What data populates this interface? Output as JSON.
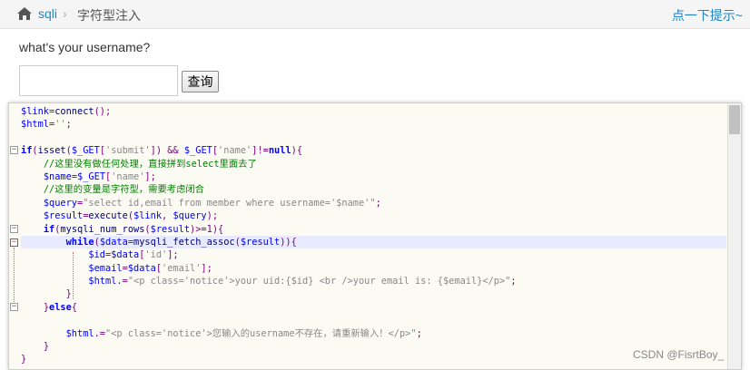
{
  "header": {
    "home_icon": "home-icon",
    "breadcrumb_sqli": "sqli",
    "breadcrumb_sep": "›",
    "breadcrumb_current": "字符型注入",
    "hint_link": "点一下提示~"
  },
  "form": {
    "prompt": "what's your username?",
    "input_value": "",
    "submit_label": "查询"
  },
  "code_lines": [
    [
      [
        "var",
        "$link"
      ],
      [
        "op",
        "="
      ],
      [
        "fn",
        "connect"
      ],
      [
        "op",
        "();"
      ]
    ],
    [
      [
        "var",
        "$html"
      ],
      [
        "op",
        "="
      ],
      [
        "str",
        "''"
      ],
      [
        "op",
        ";"
      ]
    ],
    [],
    [
      [
        "kw",
        "if"
      ],
      [
        "op",
        "("
      ],
      [
        "fn",
        "isset"
      ],
      [
        "op",
        "("
      ],
      [
        "var",
        "$_GET"
      ],
      [
        "op",
        "["
      ],
      [
        "str",
        "'submit'"
      ],
      [
        "op",
        "])"
      ],
      [
        "txt",
        " "
      ],
      [
        "op",
        "&&"
      ],
      [
        "txt",
        " "
      ],
      [
        "var",
        "$_GET"
      ],
      [
        "op",
        "["
      ],
      [
        "str",
        "'name'"
      ],
      [
        "op",
        "]!="
      ],
      [
        "kw",
        "null"
      ],
      [
        "op",
        "){"
      ]
    ],
    [
      [
        "txt",
        "    "
      ],
      [
        "cmt",
        "//这里没有做任何处理，直接拼到select里面去了"
      ]
    ],
    [
      [
        "txt",
        "    "
      ],
      [
        "var",
        "$name"
      ],
      [
        "op",
        "="
      ],
      [
        "var",
        "$_GET"
      ],
      [
        "op",
        "["
      ],
      [
        "str",
        "'name'"
      ],
      [
        "op",
        "];"
      ]
    ],
    [
      [
        "txt",
        "    "
      ],
      [
        "cmt",
        "//这里的变量是字符型，需要考虑闭合"
      ]
    ],
    [
      [
        "txt",
        "    "
      ],
      [
        "var",
        "$query"
      ],
      [
        "op",
        "="
      ],
      [
        "str",
        "\"select id,email from member where username='$name'\""
      ],
      [
        "op",
        ";"
      ]
    ],
    [
      [
        "txt",
        "    "
      ],
      [
        "var",
        "$result"
      ],
      [
        "op",
        "="
      ],
      [
        "fn",
        "execute"
      ],
      [
        "op",
        "("
      ],
      [
        "var",
        "$link"
      ],
      [
        "op",
        ","
      ],
      [
        "txt",
        " "
      ],
      [
        "var",
        "$query"
      ],
      [
        "op",
        ");"
      ]
    ],
    [
      [
        "txt",
        "    "
      ],
      [
        "kw",
        "if"
      ],
      [
        "op",
        "("
      ],
      [
        "fn",
        "mysqli_num_rows"
      ],
      [
        "op",
        "("
      ],
      [
        "var",
        "$result"
      ],
      [
        "op",
        ")>=1){"
      ]
    ],
    [
      [
        "txt",
        "        "
      ],
      [
        "kw",
        "while"
      ],
      [
        "op",
        "("
      ],
      [
        "var",
        "$data"
      ],
      [
        "op",
        "="
      ],
      [
        "fn",
        "mysqli_fetch_assoc"
      ],
      [
        "op",
        "("
      ],
      [
        "var",
        "$result"
      ],
      [
        "op",
        "))"
      ],
      [
        "op",
        "{"
      ]
    ],
    [
      [
        "txt",
        "            "
      ],
      [
        "var",
        "$id"
      ],
      [
        "op",
        "="
      ],
      [
        "var",
        "$data"
      ],
      [
        "op",
        "["
      ],
      [
        "str",
        "'id'"
      ],
      [
        "op",
        "];"
      ]
    ],
    [
      [
        "txt",
        "            "
      ],
      [
        "var",
        "$email"
      ],
      [
        "op",
        "="
      ],
      [
        "var",
        "$data"
      ],
      [
        "op",
        "["
      ],
      [
        "str",
        "'email'"
      ],
      [
        "op",
        "];"
      ]
    ],
    [
      [
        "txt",
        "            "
      ],
      [
        "var",
        "$html"
      ],
      [
        "op",
        ".="
      ],
      [
        "str",
        "\"<p class='notice'>your uid:{$id} <br />your email is: {$email}</p>\""
      ],
      [
        "op",
        ";"
      ]
    ],
    [
      [
        "txt",
        "        "
      ],
      [
        "op",
        "}"
      ]
    ],
    [
      [
        "txt",
        "    "
      ],
      [
        "op",
        "}"
      ],
      [
        "kw",
        "else"
      ],
      [
        "op",
        "{"
      ]
    ],
    [],
    [
      [
        "txt",
        "        "
      ],
      [
        "var",
        "$html"
      ],
      [
        "op",
        ".="
      ],
      [
        "str",
        "\"<p class='notice'>您输入的username不存在，请重新输入！</p>\""
      ],
      [
        "op",
        ";"
      ]
    ],
    [
      [
        "txt",
        "    "
      ],
      [
        "op",
        "}"
      ]
    ],
    [
      [
        "op",
        "}"
      ]
    ]
  ],
  "watermark": "CSDN @FisrtBoy_",
  "colors": {
    "link": "#2283c5",
    "code_bg": "#fbfaf3",
    "line_highlight": "#e8eaff"
  }
}
